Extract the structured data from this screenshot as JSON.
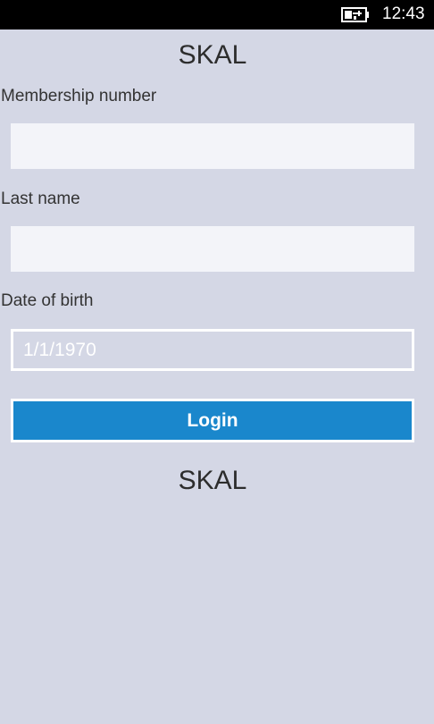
{
  "status_bar": {
    "battery_icon": "battery-charging-icon",
    "time": "12:43"
  },
  "header": {
    "title": "SKAL"
  },
  "form": {
    "membership_label": "Membership number",
    "membership_value": "",
    "last_name_label": "Last name",
    "last_name_value": "",
    "dob_label": "Date of birth",
    "dob_value": "1/1/1970",
    "login_label": "Login"
  },
  "footer": {
    "title": "SKAL"
  },
  "colors": {
    "background": "#d4d7e5",
    "input_background": "#f3f4f9",
    "accent": "#1a87cc",
    "status_bar": "#000000"
  }
}
